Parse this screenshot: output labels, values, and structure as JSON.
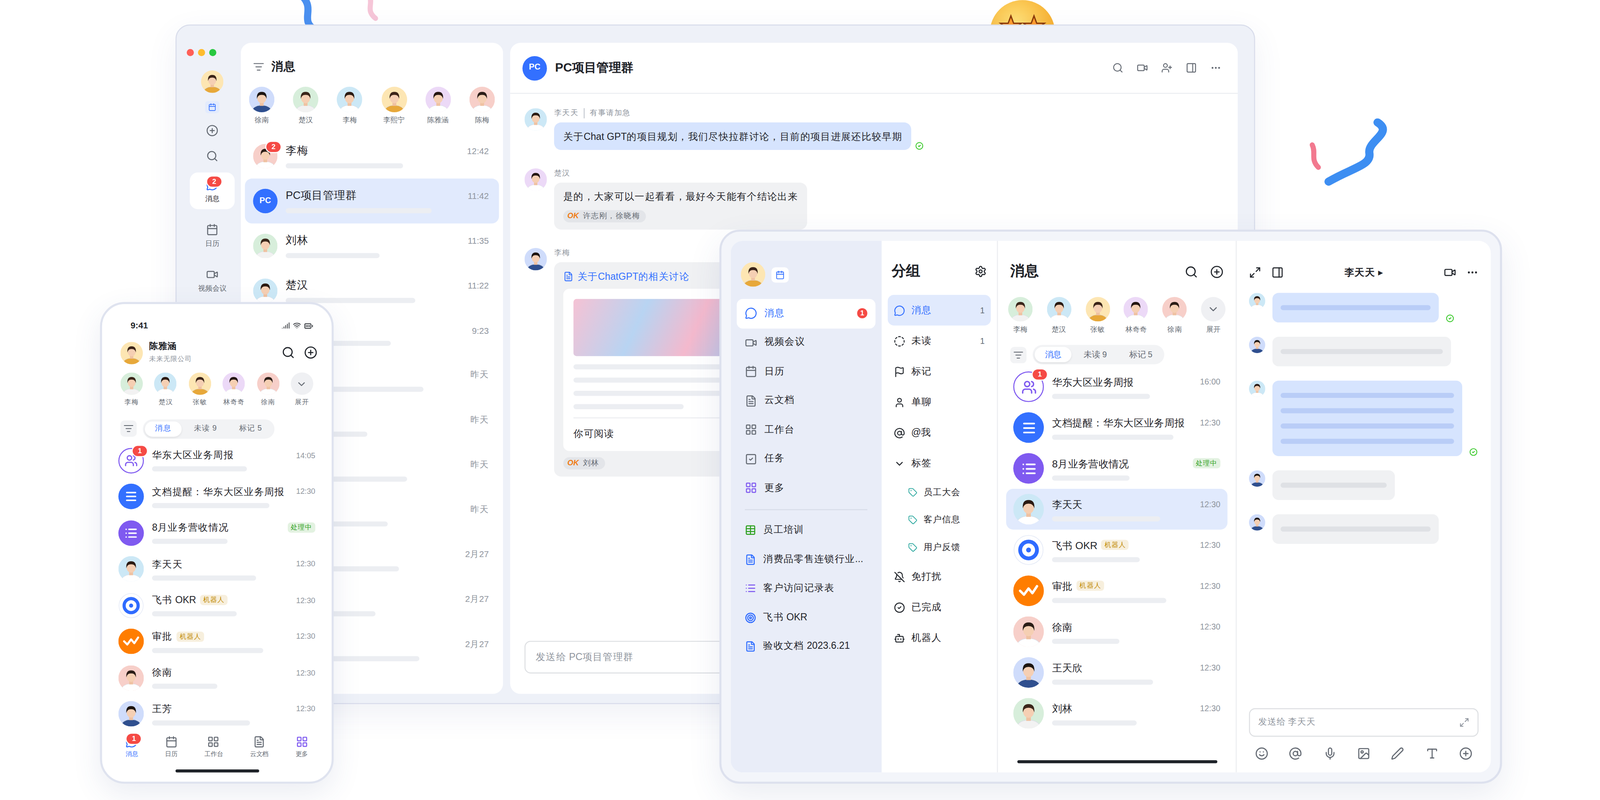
{
  "desktop": {
    "rail": [
      {
        "label": "消息",
        "badge": "2",
        "selected": true,
        "kind": "message"
      },
      {
        "label": "日历",
        "selected": false,
        "kind": "calendar"
      },
      {
        "label": "视频会议",
        "selected": false,
        "kind": "video"
      }
    ],
    "list": {
      "title": "消息",
      "contacts": [
        "徐南",
        "楚汉",
        "李梅",
        "李熙宁",
        "陈雅涵",
        "陈梅"
      ],
      "chats": [
        {
          "name": "李梅",
          "time": "12:42",
          "badge": "2",
          "selected": false,
          "kind": "person"
        },
        {
          "name": "PC项目管理群",
          "avatar": "PC",
          "time": "11:42",
          "selected": true,
          "kind": "team"
        },
        {
          "name": "刘林",
          "time": "11:35",
          "selected": false,
          "kind": "person"
        },
        {
          "name": "楚汉",
          "time": "11:22",
          "selected": false,
          "kind": "person"
        },
        {
          "time": "9:23",
          "selected": false,
          "kind": "person"
        },
        {
          "time": "昨天",
          "selected": false,
          "kind": "person"
        },
        {
          "time": "昨天",
          "selected": false,
          "kind": "person"
        },
        {
          "time": "昨天",
          "selected": false,
          "kind": "person"
        },
        {
          "time": "昨天",
          "selected": false,
          "kind": "person"
        },
        {
          "time": "2月27",
          "selected": false,
          "kind": "person"
        },
        {
          "time": "2月27",
          "selected": false,
          "kind": "person"
        },
        {
          "time": "2月27",
          "selected": false,
          "kind": "person"
        }
      ]
    },
    "chat": {
      "title": "PC项目管理群",
      "avatar": "PC",
      "messages": [
        {
          "kind": "text",
          "sender": "李天天",
          "note": "有事请加急",
          "text": "关于Chat GPT的项目规划，我们尽快拉群讨论，目前的项目进展还比较早期",
          "highlighted": true,
          "read": true
        },
        {
          "kind": "text",
          "sender": "楚汉",
          "text": "是的，大家可以一起看看，最好今天能有个结论出来",
          "highlighted": false,
          "read": false,
          "reaction": {
            "emoji": "OK",
            "users": "许志刚，徐晓梅"
          }
        },
        {
          "kind": "doc",
          "sender": "李梅",
          "doc_title": "关于ChatGPT的相关讨论",
          "footer": "你可阅读",
          "highlighted": false,
          "read": false,
          "reaction": {
            "emoji": "OK",
            "users": "刘林"
          }
        }
      ],
      "input_placeholder": "发送给 PC项目管理群"
    }
  },
  "phone": {
    "status_time": "9:41",
    "user": {
      "name": "陈雅涵",
      "company": "未来无限公司"
    },
    "contacts": [
      "李梅",
      "楚汉",
      "张敏",
      "林奇奇",
      "徐南"
    ],
    "expand": "展开",
    "tabs": [
      {
        "label": "消息",
        "selected": true
      },
      {
        "label": "未读 9",
        "selected": false
      },
      {
        "label": "标记 5",
        "selected": false
      }
    ],
    "chats": [
      {
        "name": "华东大区业务周报",
        "time": "14:05",
        "badge": "1",
        "kind": "group",
        "selected": false
      },
      {
        "name": "文档提醒：华东大区业务周报",
        "time": "12:30",
        "kind": "doc",
        "selected": false
      },
      {
        "name": "8月业务营收情况",
        "tag": "处理中",
        "tag_color": "#2ea121",
        "kind": "report",
        "selected": false
      },
      {
        "name": "李天天",
        "time": "12:30",
        "kind": "person",
        "selected": false
      },
      {
        "name": "飞书 OKR",
        "tag": "机器人",
        "tag_color": "#c28a00",
        "time": "12:30",
        "kind": "okr",
        "selected": false
      },
      {
        "name": "审批",
        "tag": "机器人",
        "tag_color": "#c28a00",
        "time": "12:30",
        "kind": "approval",
        "selected": false
      },
      {
        "name": "徐南",
        "time": "12:30",
        "kind": "person",
        "selected": false
      },
      {
        "name": "王芳",
        "time": "12:30",
        "kind": "person",
        "selected": false
      }
    ],
    "nav": [
      {
        "label": "消息",
        "badge": "1",
        "selected": true,
        "kind": "message"
      },
      {
        "label": "日历",
        "selected": false,
        "kind": "calendar"
      },
      {
        "label": "工作台",
        "selected": false,
        "kind": "workspace"
      },
      {
        "label": "云文档",
        "selected": false,
        "kind": "docs"
      },
      {
        "label": "更多",
        "selected": false,
        "kind": "more"
      }
    ]
  },
  "tablet": {
    "nav": [
      {
        "label": "消息",
        "badge": "1",
        "selected": true,
        "kind": "message"
      },
      {
        "label": "视频会议",
        "selected": false,
        "kind": "video"
      },
      {
        "label": "日历",
        "selected": false,
        "kind": "calendar"
      },
      {
        "label": "云文档",
        "selected": false,
        "kind": "docs"
      },
      {
        "label": "工作台",
        "selected": false,
        "kind": "workspace"
      },
      {
        "label": "任务",
        "selected": false,
        "kind": "task"
      },
      {
        "label": "更多",
        "selected": false,
        "kind": "more"
      }
    ],
    "pinned": [
      {
        "label": "员工培训",
        "kind": "sheet",
        "color": "#2ea121"
      },
      {
        "label": "消费品零售连锁行业...",
        "kind": "doc",
        "color": "#3370ff"
      },
      {
        "label": "客户访问记录表",
        "kind": "base",
        "color": "#7f5af0"
      },
      {
        "label": "飞书 OKR",
        "kind": "okr",
        "color": "#2f6bff"
      },
      {
        "label": "验收文档 2023.6.21",
        "kind": "doc",
        "color": "#3370ff"
      }
    ],
    "groups": {
      "title": "分组",
      "items": [
        {
          "label": "消息",
          "count": "1",
          "selected": true,
          "kind": "message"
        },
        {
          "label": "未读",
          "count": "1",
          "selected": false,
          "kind": "unread"
        },
        {
          "label": "标记",
          "selected": false,
          "kind": "flag"
        },
        {
          "label": "单聊",
          "selected": false,
          "kind": "single"
        },
        {
          "label": "@我",
          "selected": false,
          "kind": "mention"
        },
        {
          "label": "标签",
          "selected": false,
          "kind": "section",
          "expanded": true
        },
        {
          "label": "员工大会",
          "selected": false,
          "kind": "tag"
        },
        {
          "label": "客户信息",
          "selected": false,
          "kind": "tag"
        },
        {
          "label": "用户反馈",
          "selected": false,
          "kind": "tag"
        },
        {
          "label": "免打扰",
          "selected": false,
          "kind": "mute"
        },
        {
          "label": "已完成",
          "selected": false,
          "kind": "done"
        },
        {
          "label": "机器人",
          "selected": false,
          "kind": "bot"
        }
      ]
    },
    "messages": {
      "title": "消息",
      "contacts": [
        "李梅",
        "楚汉",
        "张敏",
        "林奇奇",
        "徐南"
      ],
      "expand": "展开",
      "tabs": [
        {
          "label": "消息",
          "selected": true
        },
        {
          "label": "未读 9",
          "selected": false
        },
        {
          "label": "标记 5",
          "selected": false
        }
      ],
      "chats": [
        {
          "name": "华东大区业务周报",
          "time": "16:00",
          "badge": "1",
          "kind": "group",
          "selected": false
        },
        {
          "name": "文档提醒：华东大区业务周报",
          "time": "12:30",
          "kind": "doc",
          "selected": false
        },
        {
          "name": "8月业务营收情况",
          "tag": "处理中",
          "tag_color": "#2ea121",
          "kind": "report",
          "selected": false
        },
        {
          "name": "李天天",
          "time": "12:30",
          "kind": "person",
          "selected": true
        },
        {
          "name": "飞书 OKR",
          "tag": "机器人",
          "tag_color": "#c28a00",
          "time": "12:30",
          "kind": "okr",
          "selected": false
        },
        {
          "name": "审批",
          "tag": "机器人",
          "tag_color": "#c28a00",
          "time": "12:30",
          "kind": "approval",
          "selected": false
        },
        {
          "name": "徐南",
          "time": "12:30",
          "kind": "person",
          "selected": false
        },
        {
          "name": "王天欣",
          "time": "12:30",
          "kind": "person",
          "selected": false
        },
        {
          "name": "刘林",
          "time": "12:30",
          "kind": "person",
          "selected": false
        }
      ]
    },
    "chat": {
      "title": "李天天",
      "arrow": "▸",
      "bubbles": [
        {
          "highlighted": true,
          "lines": 1,
          "read": true
        },
        {
          "highlighted": false,
          "lines": 1,
          "read": false
        },
        {
          "highlighted": true,
          "lines": 4,
          "read": true
        },
        {
          "highlighted": false,
          "lines": 1,
          "read": false
        },
        {
          "highlighted": false,
          "lines": 1,
          "read": false
        }
      ],
      "input_placeholder": "发送给 李天天"
    }
  }
}
